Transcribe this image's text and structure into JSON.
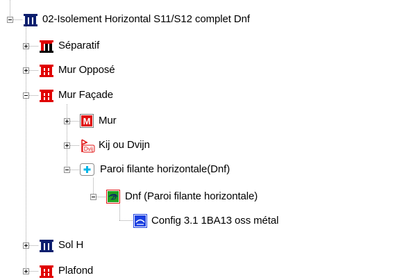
{
  "tree": {
    "nodes": [
      {
        "label": "02-Isolement Horizontal S11/S12 complet Dnf",
        "icon": "pillars-navy-icon",
        "state": "expanded"
      },
      {
        "label": "Séparatif",
        "icon": "pillars-red-black-icon",
        "state": "collapsed"
      },
      {
        "label": "Mur Opposé",
        "icon": "pillars-red-icon",
        "state": "collapsed"
      },
      {
        "label": "Mur Façade",
        "icon": "pillars-red-icon",
        "state": "expanded"
      },
      {
        "label": "Mur",
        "icon": "m-badge-icon",
        "state": "collapsed"
      },
      {
        "label": "Kij ou Dvijn",
        "icon": "dvij-flag-icon",
        "state": "collapsed"
      },
      {
        "label": "Paroi filante horizontale(Dnf)",
        "icon": "cyan-plus-box-icon",
        "state": "expanded"
      },
      {
        "label": "Dnf (Paroi filante horizontale)",
        "icon": "green-dnf-icon",
        "state": "expanded"
      },
      {
        "label": "Config 3.1 1BA13 oss métal",
        "icon": "blue-config-icon",
        "state": "leaf"
      },
      {
        "label": "Sol H",
        "icon": "pillars-navy-icon",
        "state": "collapsed"
      },
      {
        "label": "Plafond",
        "icon": "pillars-red-icon",
        "state": "collapsed"
      }
    ]
  },
  "colors": {
    "pillar_navy": "#0b1e6e",
    "pillar_red": "#e00000",
    "badge_m_red": "#e01010",
    "dnf_green": "#1fa01f",
    "config_blue": "#1a3fe0",
    "cyan_plus": "#00b4e6",
    "tree_line": "#a0a0a0"
  }
}
